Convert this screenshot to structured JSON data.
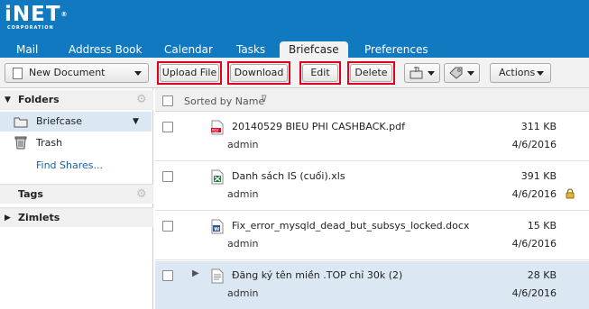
{
  "brand": {
    "logo_text": "iNET",
    "logo_sub": "CORPORATION",
    "registered": "®"
  },
  "tabs": [
    {
      "label": "Mail"
    },
    {
      "label": "Address Book"
    },
    {
      "label": "Calendar"
    },
    {
      "label": "Tasks"
    },
    {
      "label": "Briefcase",
      "active": true
    },
    {
      "label": "Preferences"
    }
  ],
  "toolbar": {
    "new_document": "New Document",
    "upload_file": "Upload File",
    "download": "Download",
    "edit": "Edit",
    "delete": "Delete",
    "actions": "Actions"
  },
  "sidebar": {
    "folders_label": "Folders",
    "briefcase": "Briefcase",
    "trash": "Trash",
    "find_shares": "Find Shares...",
    "tags_label": "Tags",
    "zimlets_label": "Zimlets"
  },
  "list": {
    "sort_label": "Sorted by Name",
    "rows": [
      {
        "name": "20140529 BIEU PHI CASHBACK.pdf",
        "owner": "admin",
        "size": "311 KB",
        "date": "4/6/2016",
        "type": "pdf",
        "locked": false,
        "selected": false
      },
      {
        "name": "Danh sách IS (cuối).xls",
        "owner": "admin",
        "size": "391 KB",
        "date": "4/6/2016",
        "type": "xls",
        "locked": true,
        "selected": false
      },
      {
        "name": "Fix_error_mysqld_dead_but_subsys_locked.docx",
        "owner": "admin",
        "size": "15 KB",
        "date": "4/6/2016",
        "type": "docx",
        "locked": false,
        "selected": false
      },
      {
        "name": "Đăng ký tên miền .TOP chỉ 30k (2)",
        "owner": "admin",
        "size": "28 KB",
        "date": "4/6/2016",
        "type": "doc",
        "locked": false,
        "selected": true
      }
    ]
  },
  "colors": {
    "header_bg": "#1179bf",
    "highlight_border": "#e00020",
    "selected_row": "#dbe7f3"
  }
}
